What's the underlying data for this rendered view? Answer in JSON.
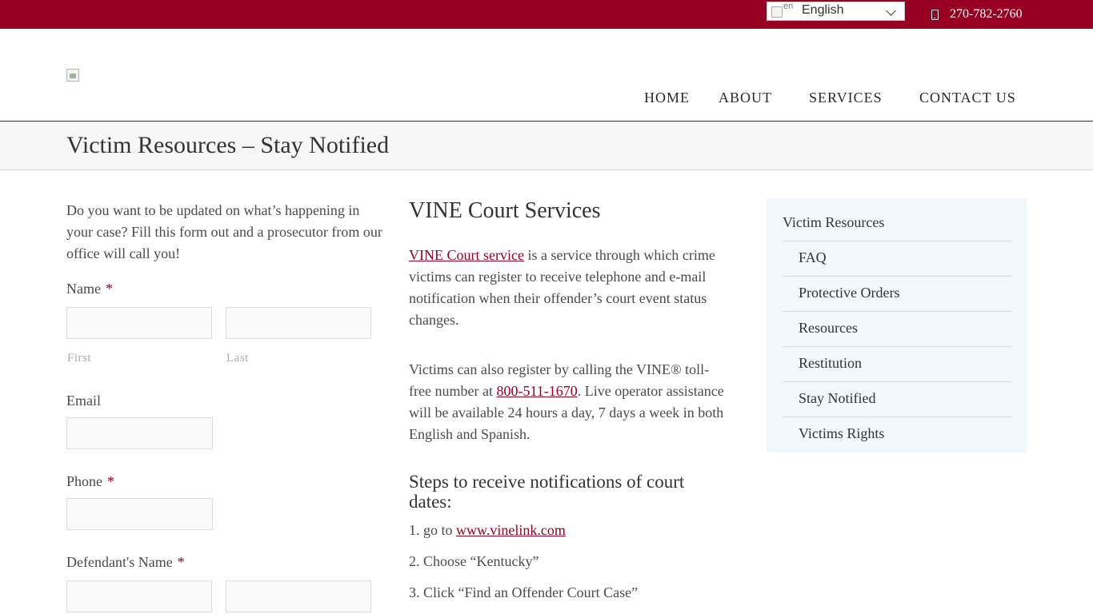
{
  "topbar": {
    "language_flag_alt": "en",
    "language_label": "English",
    "phone": "270-782-2760"
  },
  "nav": {
    "items": [
      "HOME",
      "ABOUT",
      "SERVICES",
      "CONTACT US"
    ]
  },
  "page": {
    "title": "Victim Resources – Stay Notified"
  },
  "form": {
    "intro": "Do you want to be updated on what’s happening in your case? Fill this form out and a prosecutor from our office will call you!",
    "name_label": "Name",
    "required_mark": "*",
    "first_sublabel": "First",
    "last_sublabel": "Last",
    "email_label": "Email",
    "phone_label": "Phone",
    "defendant_label": "Defendant's Name"
  },
  "main": {
    "heading": "VINE Court Services",
    "p1_link": "VINE Court service",
    "p1_rest": " is a service through which crime victims can register to receive telephone and e-mail notification when their offender’s court event status changes.",
    "p2_before": "Victims can also register by calling the VINE® toll-free number at ",
    "p2_link": "800-511-1670",
    "p2_after": ". Live operator assistance will be available 24 hours a day, 7 days a week in both English and Spanish.",
    "steps_heading": "Steps to receive notifications of court dates:",
    "step1_prefix": "1. go to ",
    "step1_link": "www.vinelink.com",
    "step2": "2. Choose “Kentucky”",
    "step3": "3. Click “Find an Offender Court Case”"
  },
  "sidebar": {
    "title": "Victim Resources",
    "items": [
      "FAQ",
      "Protective Orders",
      "Resources",
      "Restitution",
      "Stay Notified",
      "Victims Rights"
    ]
  },
  "colors": {
    "brand": "#970023",
    "sidebar_bg": "#f0f8fc"
  }
}
